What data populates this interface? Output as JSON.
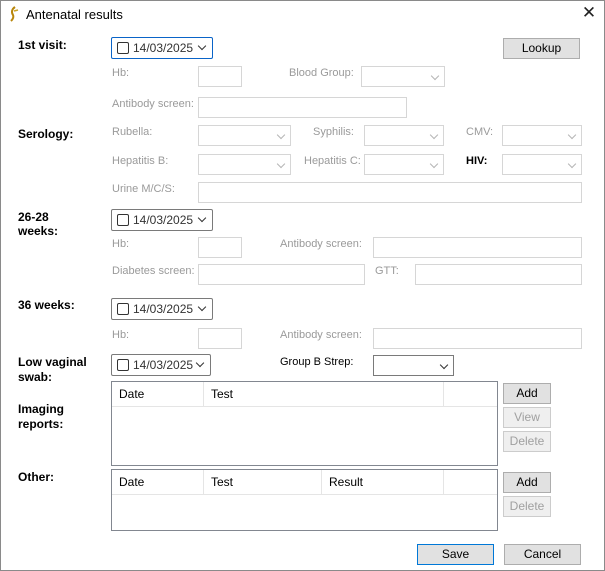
{
  "window": {
    "title": "Antenatal results",
    "close_glyph": "✕"
  },
  "lookup_button": "Lookup",
  "first_visit": {
    "section_label": "1st visit:",
    "date": "14/03/2025",
    "hb_label": "Hb:",
    "blood_group_label": "Blood Group:",
    "antibody_label": "Antibody screen:"
  },
  "serology": {
    "section_label": "Serology:",
    "rubella_label": "Rubella:",
    "syphilis_label": "Syphilis:",
    "cmv_label": "CMV:",
    "hepb_label": "Hepatitis B:",
    "hepc_label": "Hepatitis C:",
    "hiv_label": "HIV:",
    "urine_label": "Urine M/C/S:"
  },
  "weeks_26_28": {
    "section_label_line1": "26-28",
    "section_label_line2": "weeks:",
    "date": "14/03/2025",
    "hb_label": "Hb:",
    "antibody_label": "Antibody screen:",
    "diabetes_label": "Diabetes screen:",
    "gtt_label": "GTT:"
  },
  "weeks_36": {
    "section_label": "36 weeks:",
    "date": "14/03/2025",
    "hb_label": "Hb:",
    "antibody_label": "Antibody screen:"
  },
  "low_vaginal": {
    "section_label_line1": "Low vaginal",
    "section_label_line2": "swab:",
    "date": "14/03/2025",
    "gbs_label": "Group B Strep:"
  },
  "imaging": {
    "section_label_line1": "Imaging",
    "section_label_line2": "reports:",
    "columns": [
      "Date",
      "Test",
      ""
    ],
    "add": "Add",
    "view": "View",
    "delete": "Delete"
  },
  "other": {
    "section_label": "Other:",
    "columns": [
      "Date",
      "Test",
      "Result",
      ""
    ],
    "add": "Add",
    "delete": "Delete"
  },
  "footer": {
    "save": "Save",
    "cancel": "Cancel"
  },
  "colors": {
    "disabled_text": "#9a9a9a",
    "focus_border": "#0a64c8",
    "primary_border": "#0078d7"
  }
}
